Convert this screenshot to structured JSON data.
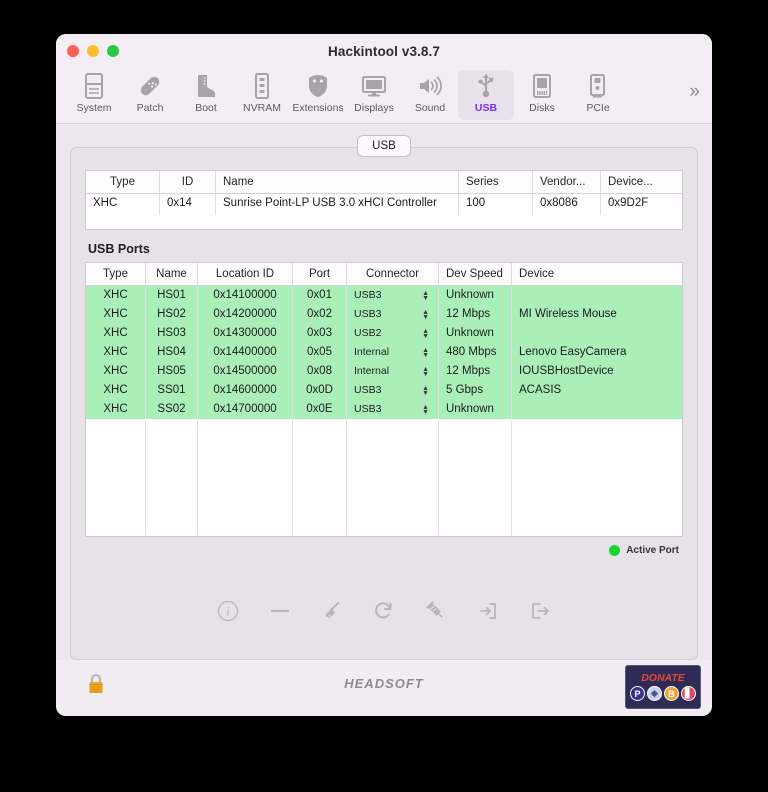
{
  "window": {
    "title": "Hackintool v3.8.7",
    "traffic_lights": [
      "close",
      "minimize",
      "zoom"
    ]
  },
  "toolbar": {
    "items": [
      {
        "label": "System",
        "icon": "computer-icon",
        "selected": false
      },
      {
        "label": "Patch",
        "icon": "bandage-icon",
        "selected": false
      },
      {
        "label": "Boot",
        "icon": "boot-icon",
        "selected": false
      },
      {
        "label": "NVRAM",
        "icon": "memory-icon",
        "selected": false
      },
      {
        "label": "Extensions",
        "icon": "shield-icon",
        "selected": false
      },
      {
        "label": "Displays",
        "icon": "monitor-icon",
        "selected": false
      },
      {
        "label": "Sound",
        "icon": "speaker-icon",
        "selected": false
      },
      {
        "label": "USB",
        "icon": "usb-icon",
        "selected": true
      },
      {
        "label": "Disks",
        "icon": "disk-icon",
        "selected": false
      },
      {
        "label": "PCIe",
        "icon": "pcie-card-icon",
        "selected": false
      }
    ],
    "overflow_label": "»",
    "selected_color": "#7a2ff2"
  },
  "tabs": {
    "active": "USB",
    "items": [
      "USB"
    ]
  },
  "controller_table": {
    "columns": [
      "Type",
      "ID",
      "Name",
      "Series",
      "Vendor...",
      "Device..."
    ],
    "rows": [
      {
        "type": "XHC",
        "id": "0x14",
        "name": "Sunrise Point-LP USB 3.0 xHCI Controller",
        "series": "100",
        "vendor": "0x8086",
        "device": "0x9D2F"
      }
    ]
  },
  "ports_section": {
    "label": "USB Ports",
    "columns": [
      "Type",
      "Name",
      "Location ID",
      "Port",
      "Connector",
      "Dev Speed",
      "Device"
    ],
    "rows": [
      {
        "type": "XHC",
        "name": "HS01",
        "location_id": "0x14100000",
        "port": "0x01",
        "connector": "USB3",
        "dev_speed": "Unknown",
        "device": "",
        "active": true
      },
      {
        "type": "XHC",
        "name": "HS02",
        "location_id": "0x14200000",
        "port": "0x02",
        "connector": "USB3",
        "dev_speed": "12 Mbps",
        "device": "MI Wireless Mouse",
        "active": true
      },
      {
        "type": "XHC",
        "name": "HS03",
        "location_id": "0x14300000",
        "port": "0x03",
        "connector": "USB2",
        "dev_speed": "Unknown",
        "device": "",
        "active": true
      },
      {
        "type": "XHC",
        "name": "HS04",
        "location_id": "0x14400000",
        "port": "0x05",
        "connector": "Internal",
        "dev_speed": "480 Mbps",
        "device": "Lenovo EasyCamera",
        "active": true
      },
      {
        "type": "XHC",
        "name": "HS05",
        "location_id": "0x14500000",
        "port": "0x08",
        "connector": "Internal",
        "dev_speed": "12 Mbps",
        "device": "IOUSBHostDevice",
        "active": true
      },
      {
        "type": "XHC",
        "name": "SS01",
        "location_id": "0x14600000",
        "port": "0x0D",
        "connector": "USB3",
        "dev_speed": "5 Gbps",
        "device": "ACASIS",
        "active": true
      },
      {
        "type": "XHC",
        "name": "SS02",
        "location_id": "0x14700000",
        "port": "0x0E",
        "connector": "USB3",
        "dev_speed": "Unknown",
        "device": "",
        "active": true
      }
    ],
    "connector_options": [
      "USB2",
      "USB3",
      "Internal"
    ]
  },
  "legend": {
    "label": "Active Port",
    "color": "#19d62f"
  },
  "actions": [
    {
      "name": "info-icon",
      "title": "Info"
    },
    {
      "name": "minus-icon",
      "title": "Remove"
    },
    {
      "name": "broom-icon",
      "title": "Clean"
    },
    {
      "name": "refresh-icon",
      "title": "Refresh"
    },
    {
      "name": "syringe-icon",
      "title": "Inject"
    },
    {
      "name": "import-icon",
      "title": "Import"
    },
    {
      "name": "export-icon",
      "title": "Export"
    }
  ],
  "statusbar": {
    "lock_icon": "padlock-icon",
    "brand": "HEADSOFT",
    "donate": {
      "text": "DONATE",
      "coins": [
        "PayPal",
        "Ethereum",
        "Bitcoin",
        "Other"
      ],
      "background": "#2e2c54",
      "text_color": "#e8453c"
    }
  }
}
